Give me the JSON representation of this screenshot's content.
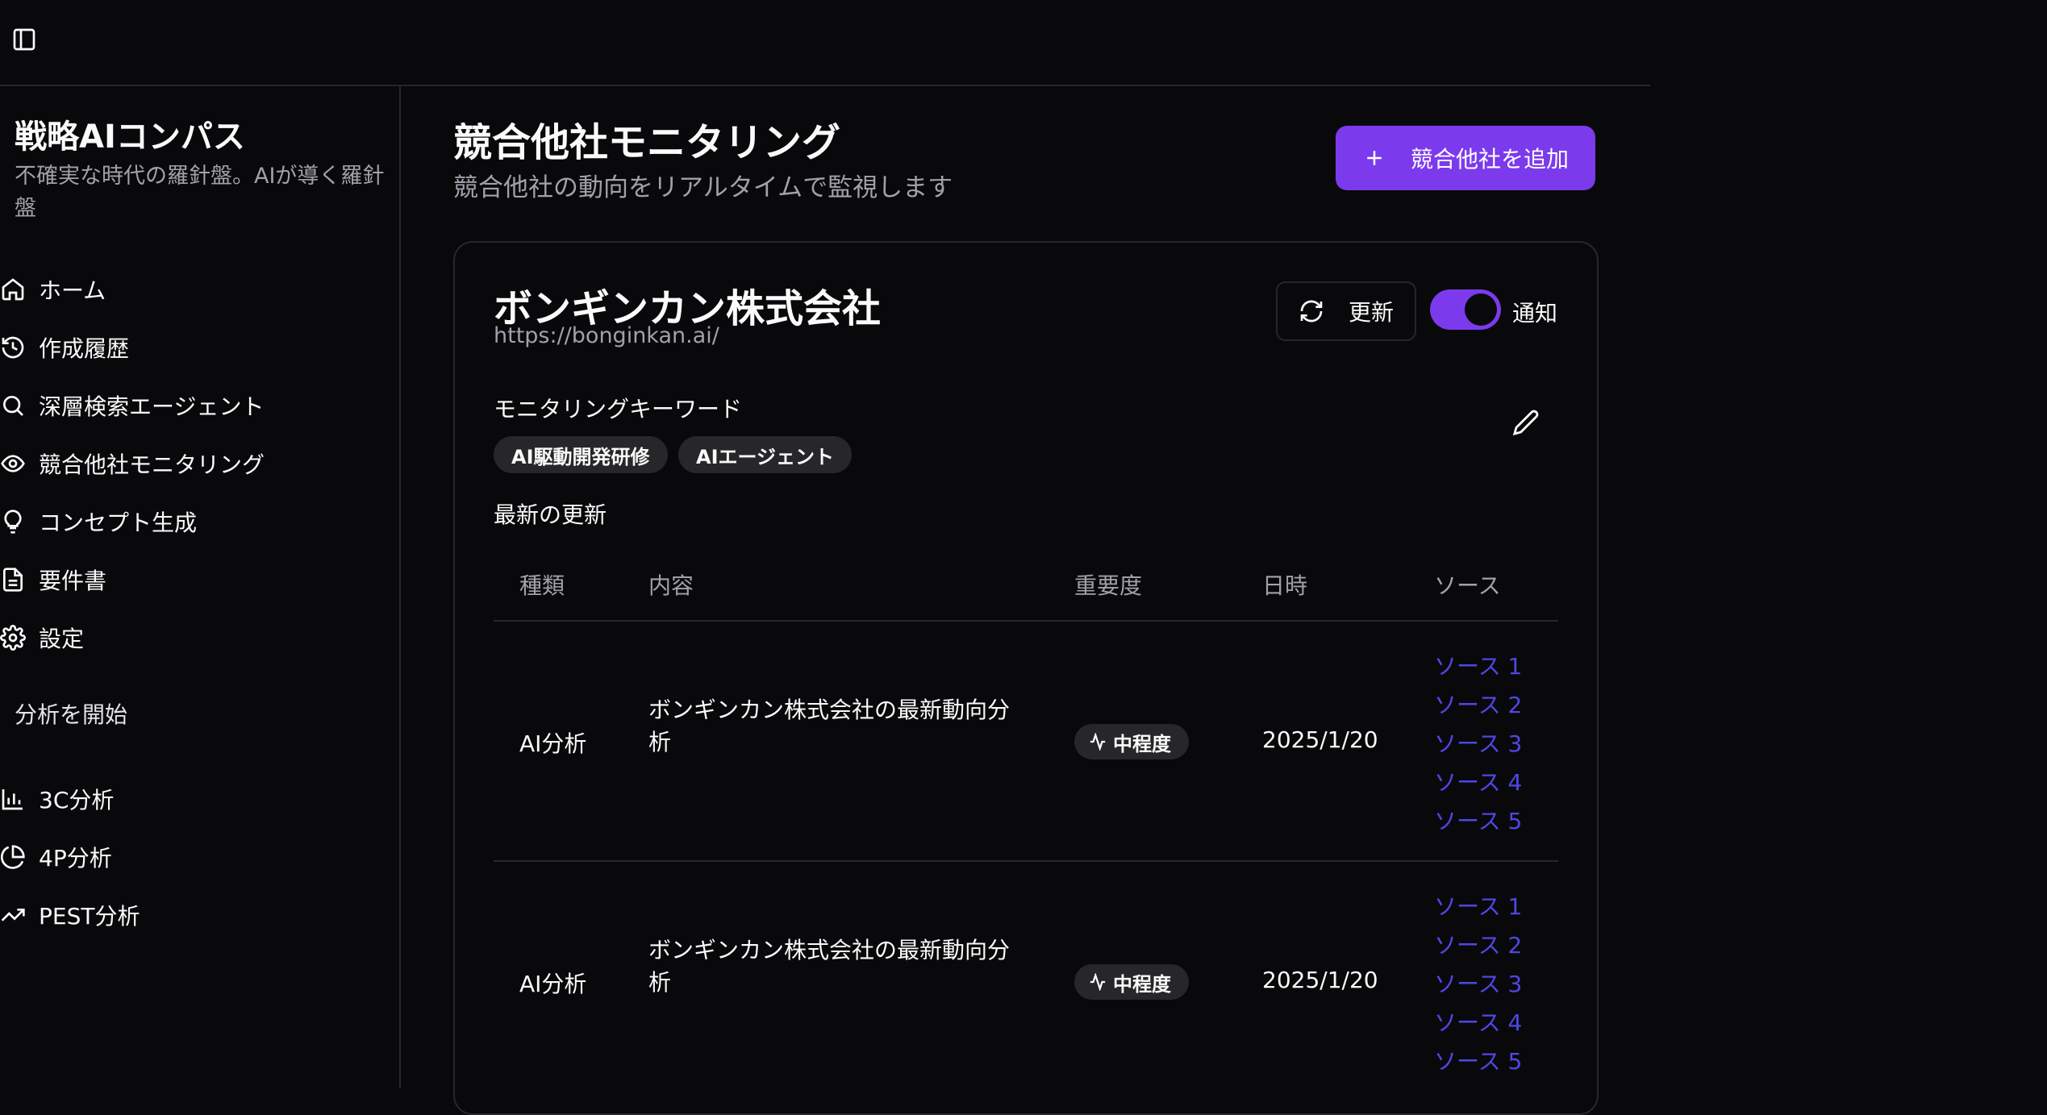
{
  "sidebar": {
    "brand": "戦略AIコンパス",
    "tagline": "不確実な時代の羅針盤。AIが導く羅針盤",
    "nav": [
      "ホーム",
      "作成履歴",
      "深層検索エージェント",
      "競合他社モニタリング",
      "コンセプト生成",
      "要件書",
      "設定"
    ],
    "section_label": "分析を開始",
    "analysis": [
      "3C分析",
      "4P分析",
      "PEST分析"
    ]
  },
  "header": {
    "title": "競合他社モニタリング",
    "subtitle": "競合他社の動向をリアルタイムで監視します",
    "add_button": "競合他社を追加"
  },
  "company": {
    "name": "ボンギンカン株式会社",
    "url": "https://bonginkan.ai/",
    "refresh_label": "更新",
    "notify_label": "通知",
    "notify_on": true,
    "keywords_label": "モニタリングキーワード",
    "keywords": [
      "AI駆動開発研修",
      "AIエージェント"
    ],
    "latest_label": "最新の更新"
  },
  "table": {
    "headers": [
      "種類",
      "内容",
      "重要度",
      "日時",
      "ソース"
    ],
    "rows": [
      {
        "type": "AI分析",
        "content": "ボンギンカン株式会社の最新動向分析",
        "importance": "中程度",
        "date": "2025/1/20",
        "sources": [
          "ソース 1",
          "ソース 2",
          "ソース 3",
          "ソース 4",
          "ソース 5"
        ]
      },
      {
        "type": "AI分析",
        "content": "ボンギンカン株式会社の最新動向分析",
        "importance": "中程度",
        "date": "2025/1/20",
        "sources": [
          "ソース 1",
          "ソース 2",
          "ソース 3",
          "ソース 4",
          "ソース 5"
        ]
      }
    ]
  },
  "colors": {
    "accent": "#7c3aed",
    "link": "#4f46e5",
    "background": "#09090b",
    "border": "#27272a"
  },
  "icons": {
    "nav": [
      "home-icon",
      "history-icon",
      "search-icon",
      "eye-icon",
      "lightbulb-icon",
      "document-icon",
      "gear-icon"
    ],
    "analysis": [
      "bar-chart-icon",
      "pie-chart-icon",
      "trending-up-icon"
    ]
  }
}
